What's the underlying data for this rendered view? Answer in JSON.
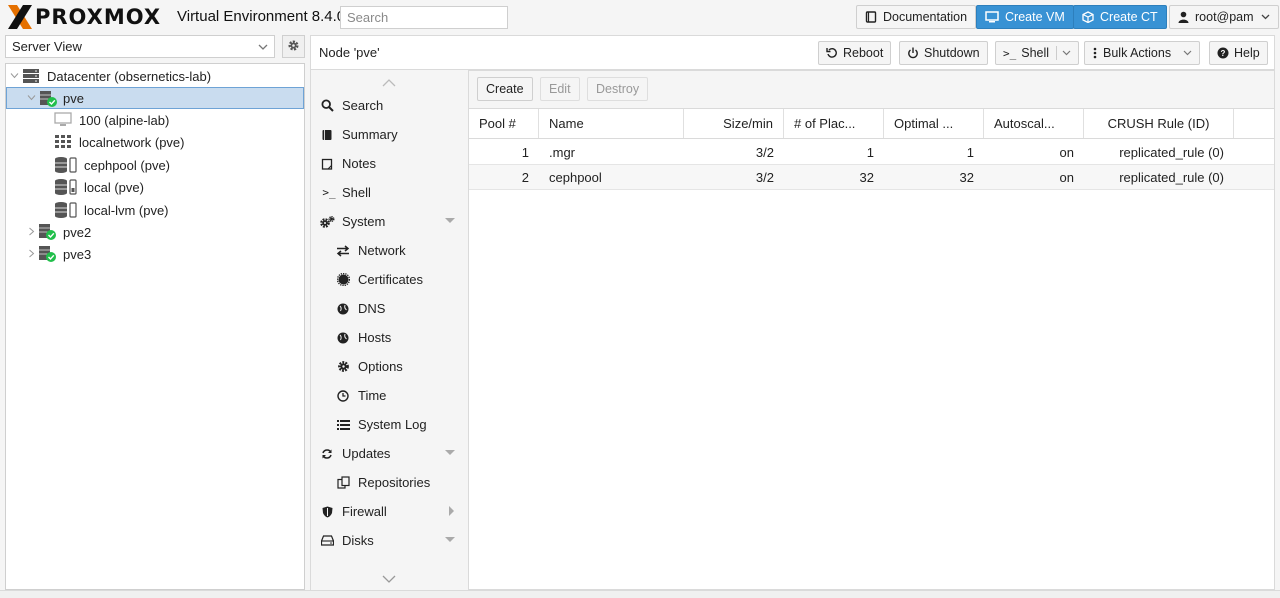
{
  "header": {
    "brand": "PROXMOX",
    "version": "Virtual Environment 8.4.0",
    "search_placeholder": "Search",
    "documentation": "Documentation",
    "create_vm": "Create VM",
    "create_ct": "Create CT",
    "user": "root@pam"
  },
  "left": {
    "view": "Server View",
    "tree": [
      {
        "label": "Datacenter (obsernetics-lab)",
        "icon": "server-stack-icon"
      },
      {
        "label": "pve",
        "icon": "node-online-icon"
      },
      {
        "label": "100 (alpine-lab)",
        "icon": "vm-monitor-icon"
      },
      {
        "label": "localnetwork (pve)",
        "icon": "network-grid-icon"
      },
      {
        "label": "cephpool (pve)",
        "icon": "storage-icon"
      },
      {
        "label": "local (pve)",
        "icon": "storage-icon"
      },
      {
        "label": "local-lvm (pve)",
        "icon": "storage-icon"
      },
      {
        "label": "pve2",
        "icon": "node-online-icon"
      },
      {
        "label": "pve3",
        "icon": "node-online-icon"
      }
    ]
  },
  "node_bar": {
    "title": "Node 'pve'",
    "reboot": "Reboot",
    "shutdown": "Shutdown",
    "shell": "Shell",
    "bulk": "Bulk Actions",
    "help": "Help"
  },
  "menu": [
    {
      "label": "Search",
      "icon": "search-icon"
    },
    {
      "label": "Summary",
      "icon": "book-icon"
    },
    {
      "label": "Notes",
      "icon": "notes-icon"
    },
    {
      "label": "Shell",
      "icon": "terminal-icon"
    },
    {
      "label": "System",
      "icon": "gears-icon"
    },
    {
      "label": "Network",
      "icon": "exchange-icon"
    },
    {
      "label": "Certificates",
      "icon": "certificate-icon"
    },
    {
      "label": "DNS",
      "icon": "globe-icon"
    },
    {
      "label": "Hosts",
      "icon": "globe-icon"
    },
    {
      "label": "Options",
      "icon": "gear-icon"
    },
    {
      "label": "Time",
      "icon": "clock-icon"
    },
    {
      "label": "System Log",
      "icon": "list-icon"
    },
    {
      "label": "Updates",
      "icon": "refresh-icon"
    },
    {
      "label": "Repositories",
      "icon": "files-icon"
    },
    {
      "label": "Firewall",
      "icon": "shield-icon"
    },
    {
      "label": "Disks",
      "icon": "hdd-icon"
    }
  ],
  "toolbar": {
    "create": "Create",
    "edit": "Edit",
    "destroy": "Destroy"
  },
  "grid": {
    "columns": [
      "Pool #",
      "Name",
      "Size/min",
      "# of Plac...",
      "Optimal ...",
      "Autoscal...",
      "CRUSH Rule (ID)"
    ],
    "rows": [
      [
        "1",
        ".mgr",
        "3/2",
        "1",
        "1",
        "on",
        "replicated_rule (0)"
      ],
      [
        "2",
        "cephpool",
        "3/2",
        "32",
        "32",
        "on",
        "replicated_rule (0)"
      ]
    ]
  },
  "colors": {
    "accent": "#3892d4",
    "selection": "#c9dcef",
    "logo_orange": "#e57000",
    "online_green": "#21bf4b"
  }
}
